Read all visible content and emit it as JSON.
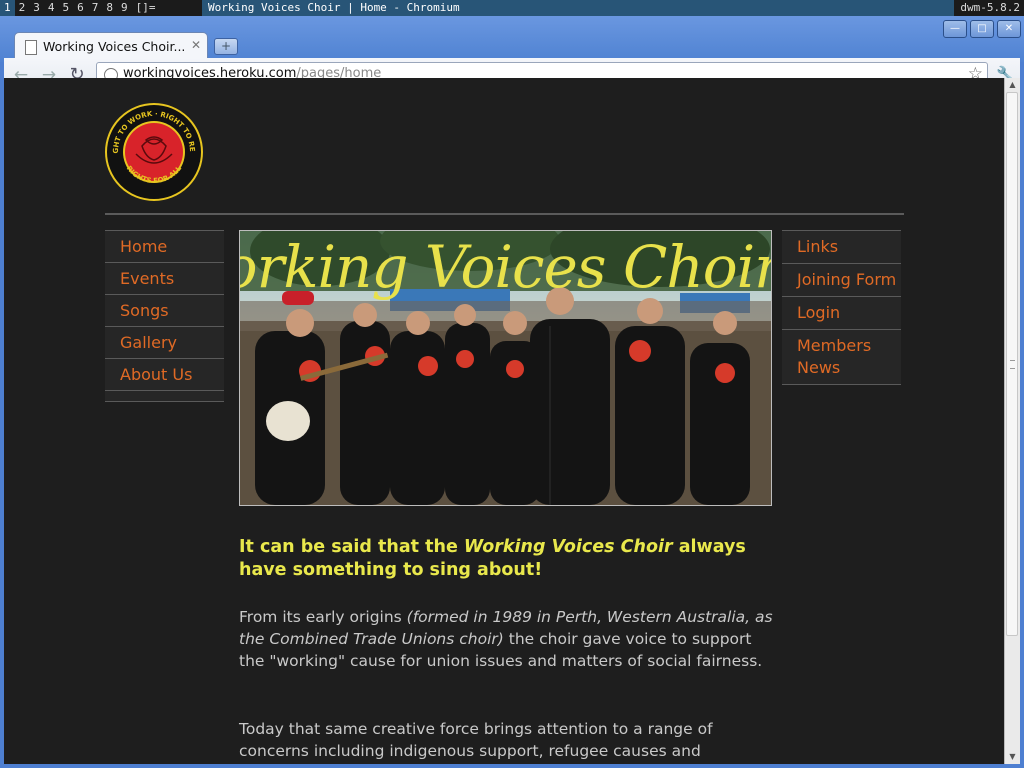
{
  "dwm": {
    "tags": [
      "1",
      "2",
      "3",
      "4",
      "5",
      "6",
      "7",
      "8",
      "9"
    ],
    "layout": "[]=",
    "window_title": "Working Voices Choir | Home - Chromium",
    "status": "dwm-5.8.2"
  },
  "browser": {
    "tab_title": "Working Voices Choir...",
    "url_host": "workingvoices.heroku.com",
    "url_path": "/pages/home",
    "icons": {
      "back": "back-arrow-icon",
      "forward": "forward-arrow-icon",
      "reload": "reload-icon",
      "star": "bookmark-star-icon",
      "wrench": "wrench-icon",
      "new_tab": "plus-icon"
    }
  },
  "page": {
    "logo": {
      "top_text": "RIGHT TO WORK · RIGHT TO REST",
      "bottom_text": "RIGHTS FOR ALL"
    },
    "banner_title": "Working Voices Choir",
    "left_nav": [
      "Home",
      "Events",
      "Songs",
      "Gallery",
      "About Us"
    ],
    "right_nav": [
      "Links",
      "Joining Form",
      "Login",
      "Members News"
    ],
    "lead": {
      "before": "It can be said that the ",
      "emph": "Working Voices Choir",
      "after": " always have something to sing about!"
    },
    "para1": {
      "before": "From its early origins ",
      "emph": "(formed in 1989 in Perth, Western Australia, as the Combined Trade Unions choir)",
      "after": " the choir gave voice to support the \"working\" cause for union issues and matters of social fairness."
    },
    "para2": "Today that same creative force brings attention to a range of concerns including indigenous support, refugee causes and",
    "colors": {
      "accent_link": "#e06a25",
      "heading_yellow": "#e9e84c",
      "background": "#1e1e1e"
    }
  }
}
